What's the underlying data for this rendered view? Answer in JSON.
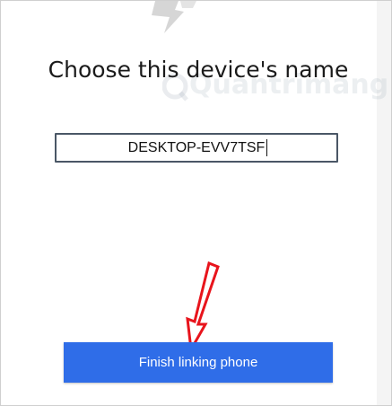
{
  "dialog": {
    "title": "Choose this device's name",
    "device_name_value": "DESKTOP-EVV7TSF",
    "finish_label": "Finish linking phone"
  },
  "colors": {
    "button": "#2f6de8",
    "button_text": "#ffffff",
    "input_border": "#4a5766",
    "annotation_arrow": "#e8141c"
  },
  "icons": {
    "top_graphic": "app-logo-icon",
    "annotation": "red-arrow-annotation-icon"
  },
  "watermark": {
    "text": "Quantrimang"
  }
}
